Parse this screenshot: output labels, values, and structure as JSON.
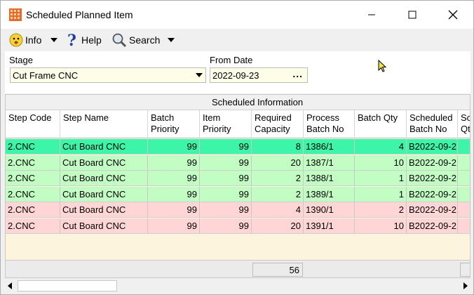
{
  "window": {
    "title": "Scheduled Planned Item"
  },
  "toolbar": {
    "info_label": "Info",
    "help_label": "Help",
    "search_label": "Search"
  },
  "filter": {
    "stage_label": "Stage",
    "stage_value": "Cut Frame CNC",
    "from_date_label": "From Date",
    "from_date_value": "2022-09-23",
    "picker_label": "..."
  },
  "grid": {
    "band_title": "Scheduled Information",
    "headers": [
      {
        "line1": "Step Code",
        "line2": ""
      },
      {
        "line1": "Step Name",
        "line2": ""
      },
      {
        "line1": "Batch",
        "line2": "Priority"
      },
      {
        "line1": "Item",
        "line2": "Priority"
      },
      {
        "line1": "Required",
        "line2": "Capacity"
      },
      {
        "line1": "Process",
        "line2": "Batch No"
      },
      {
        "line1": "Batch Qty",
        "line2": ""
      },
      {
        "line1": "Scheduled",
        "line2": "Batch No"
      },
      {
        "line1": "Sc",
        "line2": "Qty"
      }
    ],
    "rows": [
      {
        "step_code": "2.CNC",
        "step_name": "Cut Board CNC",
        "batch_priority": "99",
        "item_priority": "99",
        "required_capacity": "8",
        "process_batch_no": "1386/1",
        "batch_qty": "4",
        "scheduled_batch_no": "B2022-09-2"
      },
      {
        "step_code": "2.CNC",
        "step_name": "Cut Board CNC",
        "batch_priority": "99",
        "item_priority": "99",
        "required_capacity": "20",
        "process_batch_no": "1387/1",
        "batch_qty": "10",
        "scheduled_batch_no": "B2022-09-2"
      },
      {
        "step_code": "2.CNC",
        "step_name": "Cut Board CNC",
        "batch_priority": "99",
        "item_priority": "99",
        "required_capacity": "2",
        "process_batch_no": "1388/1",
        "batch_qty": "1",
        "scheduled_batch_no": "B2022-09-2"
      },
      {
        "step_code": "2.CNC",
        "step_name": "Cut Board CNC",
        "batch_priority": "99",
        "item_priority": "99",
        "required_capacity": "2",
        "process_batch_no": "1389/1",
        "batch_qty": "1",
        "scheduled_batch_no": "B2022-09-2"
      },
      {
        "step_code": "2.CNC",
        "step_name": "Cut Board CNC",
        "batch_priority": "99",
        "item_priority": "99",
        "required_capacity": "4",
        "process_batch_no": "1390/1",
        "batch_qty": "2",
        "scheduled_batch_no": "B2022-09-2"
      },
      {
        "step_code": "2.CNC",
        "step_name": "Cut Board CNC",
        "batch_priority": "99",
        "item_priority": "99",
        "required_capacity": "20",
        "process_batch_no": "1391/1",
        "batch_qty": "10",
        "scheduled_batch_no": "B2022-09-2"
      }
    ],
    "row_colors": [
      "#3cf5a8",
      "#c2fdc4",
      "#c2fdc4",
      "#c2fdc4",
      "#ffd5d5",
      "#ffd5d5"
    ],
    "capacity_total": "56"
  },
  "icons": {
    "app": "grid-app-icon",
    "info": "smiley-icon",
    "help": "question-icon",
    "search": "magnifier-icon"
  },
  "colors": {
    "selected_row": "#3cf5a8",
    "scheduled_row": "#c2fdc4",
    "unscheduled_row": "#ffd5d5",
    "input_bg": "#fdfde8",
    "grid_bg": "#fcf4dc"
  }
}
